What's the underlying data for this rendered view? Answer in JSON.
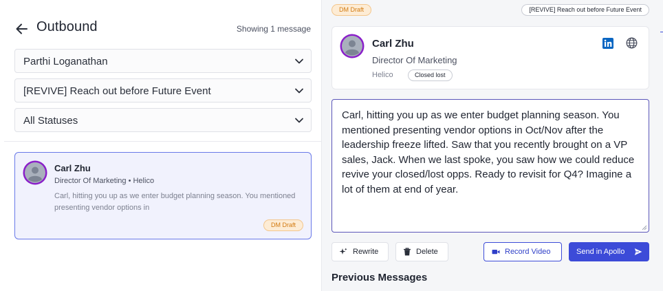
{
  "header": {
    "title": "Outbound",
    "showing": "Showing 1 message"
  },
  "filters": {
    "user": "Parthi Loganathan",
    "sequence": "[REVIVE] Reach out before Future Event",
    "status": "All Statuses"
  },
  "message_list": [
    {
      "name": "Carl Zhu",
      "subtitle": "Director Of Marketing • Helico",
      "preview": "Carl, hitting you up as we enter budget planning season. You mentioned presenting vendor options in",
      "badge": "DM Draft"
    }
  ],
  "detail": {
    "draft_badge": "DM Draft",
    "sequence_badge": "[REVIVE] Reach out before Future Event",
    "contact": {
      "name": "Carl Zhu",
      "role": "Director Of Marketing",
      "company": "Helico",
      "status": "Closed lost"
    },
    "message_body": "Carl, hitting you up as we enter budget planning season. You mentioned presenting vendor options in Oct/Nov after the leadership freeze lifted. Saw that you recently brought on a VP sales, Jack. When we last spoke, you saw how we could reduce revive your closed/lost opps. Ready to revisit for Q4? Imagine a lot of them at end of year.",
    "actions": {
      "rewrite": "Rewrite",
      "delete": "Delete",
      "record_video": "Record Video",
      "send": "Send in Apollo"
    },
    "previous_messages_title": "Previous Messages"
  },
  "colors": {
    "accent": "#3c4bd8",
    "selected_card_bg": "#f1f2fd",
    "draft_badge_bg": "#fdecd5",
    "draft_badge_text": "#d27a10",
    "avatar_ring": "#8a1fc9"
  },
  "icons": {
    "back": "arrow-left-icon",
    "chevron": "chevron-down-icon",
    "linkedin": "linkedin-icon",
    "globe": "globe-icon",
    "rewrite": "sparkle-icon",
    "delete": "trash-icon",
    "record": "video-camera-icon",
    "send": "send-arrow-icon"
  }
}
